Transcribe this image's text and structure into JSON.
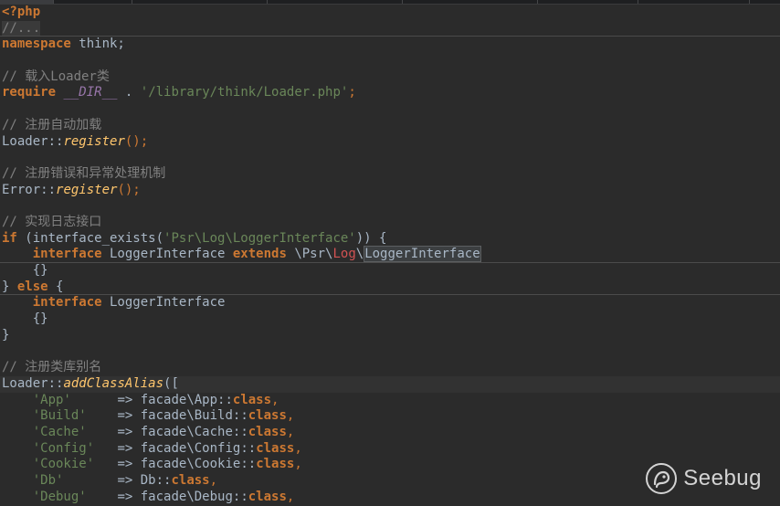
{
  "editor": {
    "lines": {
      "l1": {
        "php_open": "<?php"
      },
      "l2": {
        "fold": "//..."
      },
      "l3": {
        "kw": "namespace",
        "text": " think;"
      },
      "l5": {
        "comment": "// 载入Loader类"
      },
      "l6": {
        "kw": "require",
        "magic": "__DIR__",
        "op": " . ",
        "str": "'/library/think/Loader.php'",
        "end": ";"
      },
      "l8": {
        "comment": "// 注册自动加载"
      },
      "l9": {
        "cls": "Loader",
        "sep": "::",
        "fn": "register",
        "end": "();"
      },
      "l11": {
        "comment": "// 注册错误和异常处理机制"
      },
      "l12": {
        "cls": "Error",
        "sep": "::",
        "fn": "register",
        "end": "();"
      },
      "l14": {
        "comment": "// 实现日志接口"
      },
      "l15": {
        "kw": "if",
        "open": " (interface_exists(",
        "str": "'Psr\\Log\\LoggerInterface'",
        "close": ")) {"
      },
      "l16": {
        "kw1": "interface",
        "name": " LoggerInterface ",
        "kw2": "extends",
        "ns1": " \\Psr\\",
        "ns2": "Log",
        "ns3": "\\",
        "sel": "LoggerInterface"
      },
      "l17": {
        "text": "{}"
      },
      "l18": {
        "pre": "} ",
        "kw": "else",
        "post": " {"
      },
      "l19": {
        "kw": "interface",
        "name": " LoggerInterface"
      },
      "l20": {
        "text": "{}"
      },
      "l21": {
        "text": "}"
      },
      "l23": {
        "comment": "// 注册类库别名"
      },
      "l24": {
        "cls": "Loader",
        "sep": "::",
        "fn": "addClassAlias",
        "end": "(["
      },
      "aliases": [
        {
          "key": "'App'",
          "pad": "      ",
          "arrow": "=>",
          "target": " facade\\App",
          "sep": "::",
          "kw": "class",
          "end": ","
        },
        {
          "key": "'Build'",
          "pad": "    ",
          "arrow": "=>",
          "target": " facade\\Build",
          "sep": "::",
          "kw": "class",
          "end": ","
        },
        {
          "key": "'Cache'",
          "pad": "    ",
          "arrow": "=>",
          "target": " facade\\Cache",
          "sep": "::",
          "kw": "class",
          "end": ","
        },
        {
          "key": "'Config'",
          "pad": "   ",
          "arrow": "=>",
          "target": " facade\\Config",
          "sep": "::",
          "kw": "class",
          "end": ","
        },
        {
          "key": "'Cookie'",
          "pad": "   ",
          "arrow": "=>",
          "target": " facade\\Cookie",
          "sep": "::",
          "kw": "class",
          "end": ","
        },
        {
          "key": "'Db'",
          "pad": "       ",
          "arrow": "=>",
          "target": " Db",
          "sep": "::",
          "kw": "class",
          "end": ","
        },
        {
          "key": "'Debug'",
          "pad": "    ",
          "arrow": "=>",
          "target": " facade\\Debug",
          "sep": "::",
          "kw": "class",
          "end": ","
        }
      ]
    }
  },
  "watermark": {
    "text": "Seebug",
    "icon": "seebug-logo-icon"
  },
  "colors": {
    "background": "#2b2b2b",
    "keyword": "#cc7832",
    "string": "#6a8759",
    "comment": "#808080",
    "function": "#ffc66d",
    "magic_constant": "#9876aa",
    "default_text": "#a9b7c6"
  }
}
